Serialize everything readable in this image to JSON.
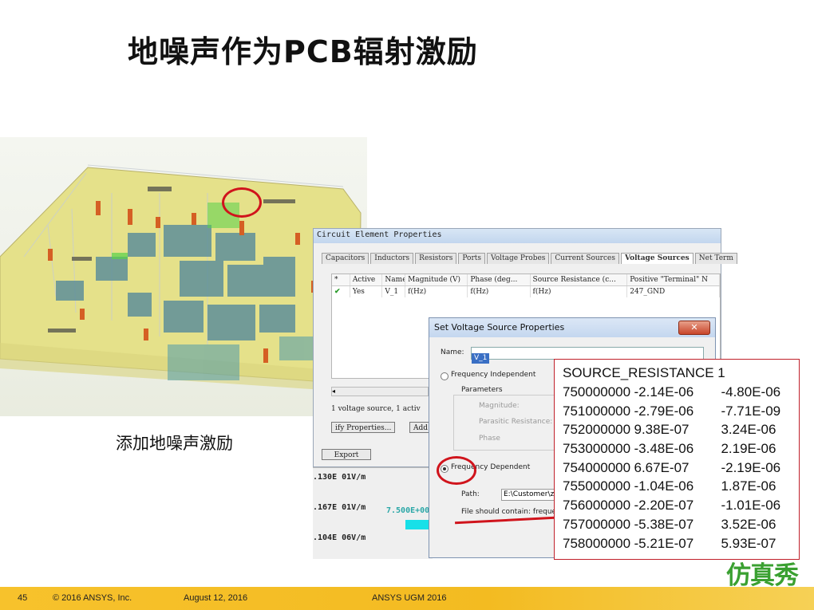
{
  "slide": {
    "title": "地噪声作为PCB辐射激励",
    "caption": "添加地噪声激励"
  },
  "circuit_dialog": {
    "title": "Circuit Element Properties",
    "tabs": [
      "Capacitors",
      "Inductors",
      "Resistors",
      "Ports",
      "Voltage Probes",
      "Current Sources",
      "Voltage Sources",
      "Net Term"
    ],
    "active_tab": "Voltage Sources",
    "columns": [
      "Active",
      "Name",
      "Magnitude (V)",
      "Phase (deg...",
      "Source Resistance (c...",
      "Positive \"Terminal\" N"
    ],
    "row": {
      "active": "Yes",
      "name": "V_1",
      "magnitude": "f(Hz)",
      "phase": "f(Hz)",
      "source_resistance": "f(Hz)",
      "positive_terminal": "247_GND"
    },
    "status": "1 voltage source, 1 activ",
    "modify_button": "ify Properties...",
    "add_button": "Add",
    "export_button": "Export",
    "scroll_left": "◂"
  },
  "field_values": {
    "rows": [
      ".130E 01V/m",
      ".167E 01V/m",
      ".104E 06V/m"
    ],
    "marker": "7.500E+00"
  },
  "voltage_dialog": {
    "title": "Set Voltage Source Properties",
    "close": "✕",
    "name_label": "Name:",
    "name_value": "V_1",
    "freq_independent": "Frequency Independent",
    "parameters": "Parameters",
    "magnitude": "Magnitude:",
    "parasitic": "Parasitic Resistance:",
    "phase": "Phase",
    "freq_dependent": "Frequency Dependent",
    "path_label": "Path:",
    "path_value": "E:\\Customer\\zhz\\GNE_",
    "file_hint": "File should contain: frequencies(Hz"
  },
  "source_table": {
    "heading": "SOURCE_RESISTANCE 1",
    "rows": [
      [
        "750000000",
        "-2.14E-06",
        "-4.80E-06"
      ],
      [
        "751000000",
        "-2.79E-06",
        "-7.71E-09"
      ],
      [
        "752000000",
        "9.38E-07",
        "3.24E-06"
      ],
      [
        "753000000",
        "-3.48E-06",
        "2.19E-06"
      ],
      [
        "754000000",
        "6.67E-07",
        "-2.19E-06"
      ],
      [
        "755000000",
        "-1.04E-06",
        "1.87E-06"
      ],
      [
        "756000000",
        "-2.20E-07",
        "-1.01E-06"
      ],
      [
        "757000000",
        "-5.38E-07",
        "3.52E-06"
      ],
      [
        "758000000",
        "-5.21E-07",
        "5.93E-07"
      ]
    ]
  },
  "logo": "仿真秀",
  "footer": {
    "page": "45",
    "copyright": "© 2016 ANSYS, Inc.",
    "date": "August 12, 2016",
    "event": "ANSYS UGM 2016"
  },
  "colors": {
    "accent_red": "#d0141c",
    "footer_yellow": "#f5c02a",
    "logo_green": "#3aa031",
    "cyan_bar": "#17e0e8"
  }
}
